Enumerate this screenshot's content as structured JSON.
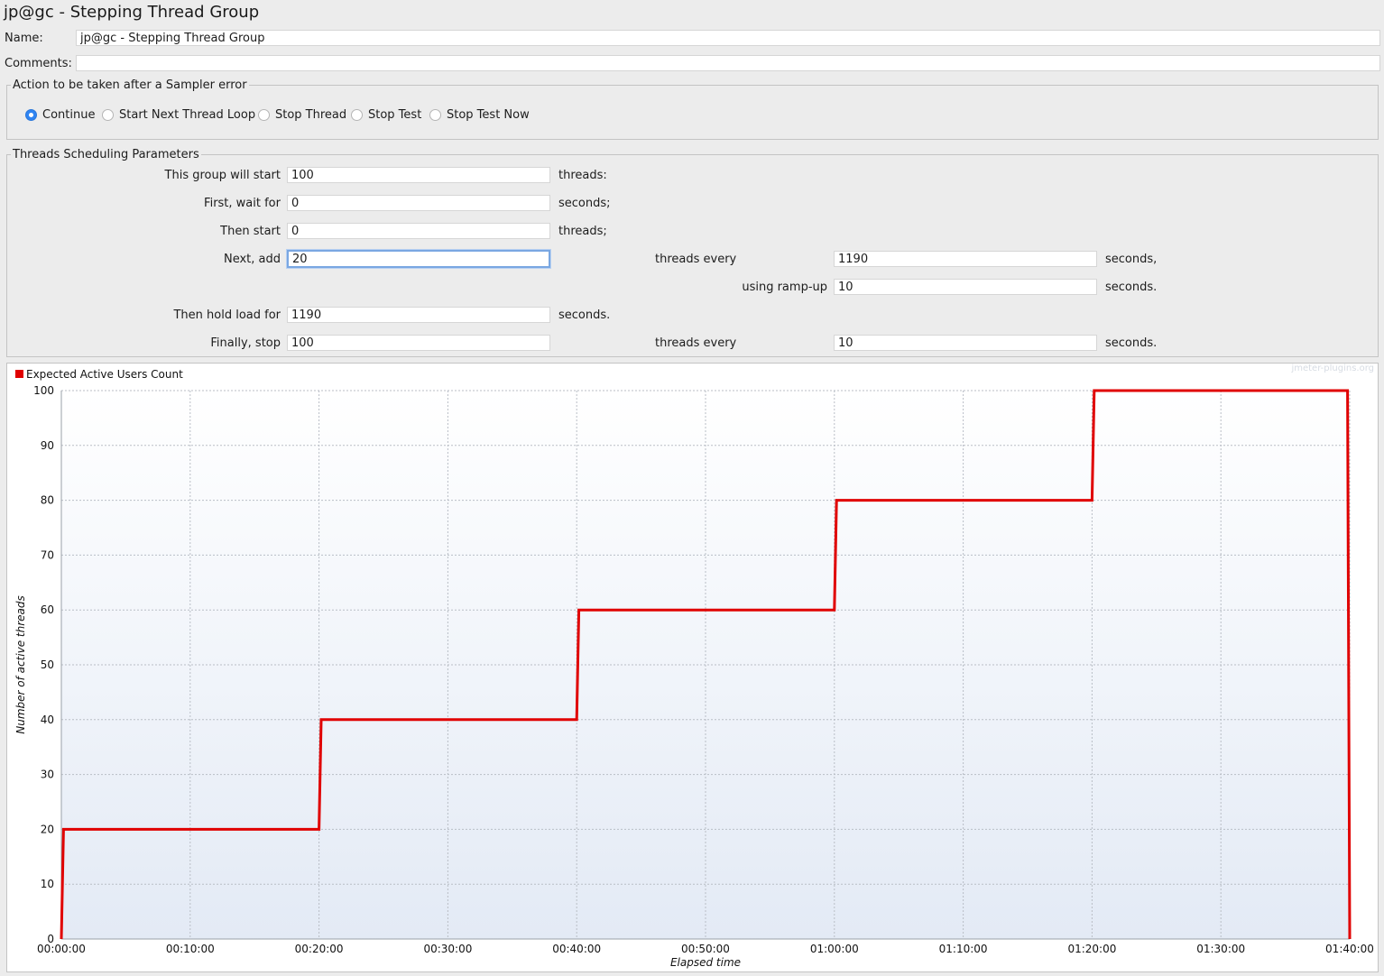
{
  "window": {
    "title": "jp@gc - Stepping Thread Group"
  },
  "form": {
    "name_label": "Name:",
    "name_value": "jp@gc - Stepping Thread Group",
    "comments_label": "Comments:",
    "comments_value": ""
  },
  "sampler_error": {
    "legend": "Action to be taken after a Sampler error",
    "options": [
      {
        "label": "Continue",
        "selected": true
      },
      {
        "label": "Start Next Thread Loop",
        "selected": false
      },
      {
        "label": "Stop Thread",
        "selected": false
      },
      {
        "label": "Stop Test",
        "selected": false
      },
      {
        "label": "Stop Test Now",
        "selected": false
      }
    ]
  },
  "scheduling": {
    "legend": "Threads Scheduling Parameters",
    "start_label": "This group will start",
    "start_value": "100",
    "start_unit": "threads:",
    "wait_label": "First, wait for",
    "wait_value": "0",
    "wait_unit": "seconds;",
    "then_start_label": "Then start",
    "then_start_value": "0",
    "then_start_unit": "threads;",
    "next_add_label": "Next, add",
    "next_add_value": "20",
    "threads_every_label": "threads every",
    "threads_every_value": "1190",
    "threads_every_unit": "seconds,",
    "ramp_up_label": "using ramp-up",
    "ramp_up_value": "10",
    "ramp_up_unit": "seconds.",
    "hold_label": "Then hold load for",
    "hold_value": "1190",
    "hold_unit": "seconds.",
    "stop_label": "Finally, stop",
    "stop_value": "100",
    "stop_every_label": "threads every",
    "stop_every_value": "10",
    "stop_every_unit": "seconds."
  },
  "chart_data": {
    "type": "line",
    "watermark": "jmeter-plugins.org",
    "legend": [
      {
        "name": "Expected Active Users Count",
        "color": "#e00000"
      }
    ],
    "xlabel": "Elapsed time",
    "ylabel": "Number of active threads",
    "xlim_seconds": [
      0,
      6000
    ],
    "ylim": [
      0,
      100
    ],
    "x_ticks": [
      "00:00:00",
      "00:10:00",
      "00:20:00",
      "00:30:00",
      "00:40:00",
      "00:50:00",
      "01:00:00",
      "01:10:00",
      "01:20:00",
      "01:30:00",
      "01:40:00"
    ],
    "y_ticks": [
      0,
      10,
      20,
      30,
      40,
      50,
      60,
      70,
      80,
      90,
      100
    ],
    "grid": true,
    "series": [
      {
        "name": "Expected Active Users Count",
        "color": "#e00000",
        "points": [
          [
            0,
            0
          ],
          [
            10,
            20
          ],
          [
            1200,
            20
          ],
          [
            1210,
            40
          ],
          [
            2400,
            40
          ],
          [
            2410,
            60
          ],
          [
            3600,
            60
          ],
          [
            3610,
            80
          ],
          [
            4800,
            80
          ],
          [
            4810,
            100
          ],
          [
            5990,
            100
          ],
          [
            6000,
            0
          ]
        ]
      }
    ]
  }
}
